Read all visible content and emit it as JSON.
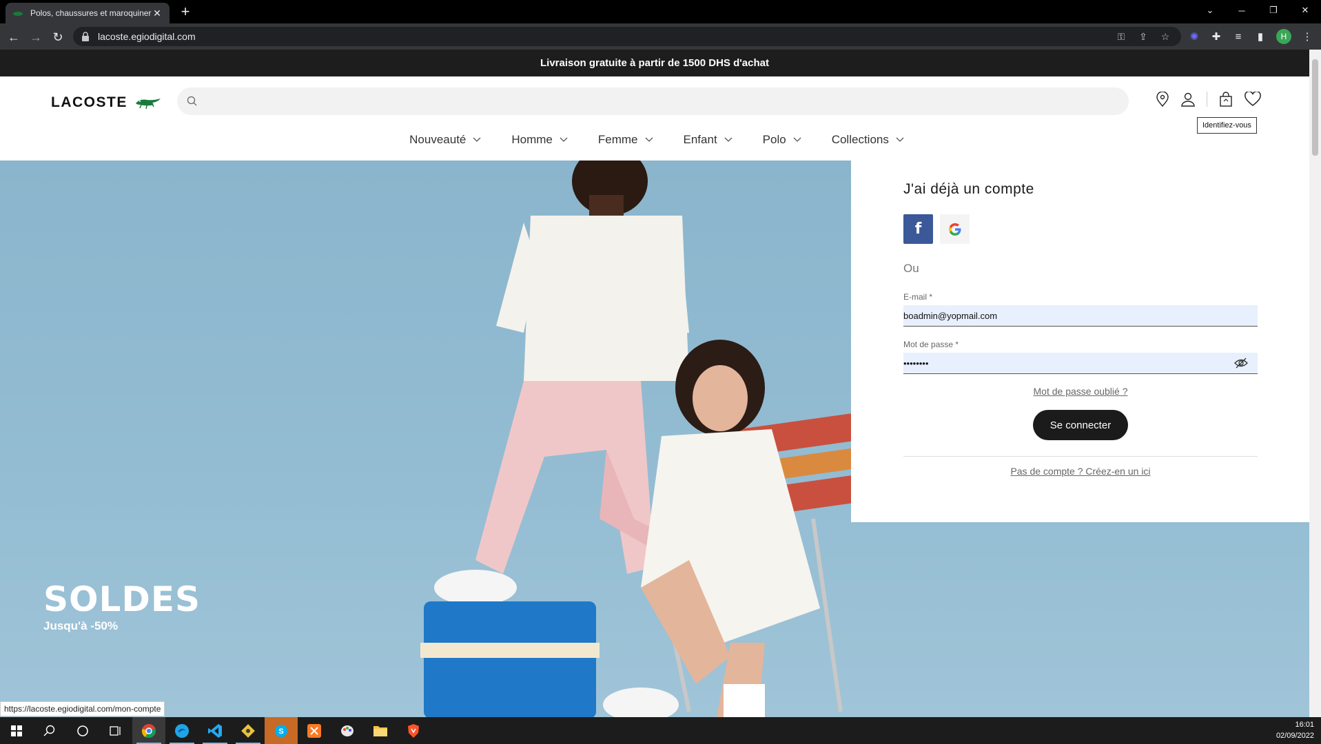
{
  "browser": {
    "tab_title": "Polos, chaussures et maroquinerie",
    "url": "lacoste.egiodigital.com",
    "new_tab_label": "+",
    "close_tab_label": "✕",
    "profile_initial": "H"
  },
  "promo": {
    "text": "Livraison gratuite à partir de 1500 DHS d'achat"
  },
  "header": {
    "logo_text": "LACOSTE",
    "search_placeholder": "",
    "tooltip": "Identifiez-vous"
  },
  "nav": {
    "items": [
      {
        "label": "Nouveauté"
      },
      {
        "label": "Homme"
      },
      {
        "label": "Femme"
      },
      {
        "label": "Enfant"
      },
      {
        "label": "Polo"
      },
      {
        "label": "Collections"
      }
    ]
  },
  "hero": {
    "title": "SOLDES",
    "subtitle": "Jusqu'à -50%"
  },
  "login": {
    "title": "J'ai déjà un compte",
    "facebook_label": "f",
    "or_label": "Ou",
    "email_label": "E-mail *",
    "email_value": "boadmin@yopmail.com",
    "password_label": "Mot de passe *",
    "password_value": "••••••••",
    "forgot_link": "Mot de passe oublié ?",
    "submit_label": "Se connecter",
    "create_link": "Pas de compte ? Créez-en un ici"
  },
  "status_bar": {
    "url": "https://lacoste.egiodigital.com/mon-compte"
  },
  "taskbar": {
    "time": "16:01",
    "date": "02/09/2022"
  },
  "colors": {
    "promo_bg": "#1d1d1d",
    "facebook": "#3b5998",
    "lacoste_green": "#004526",
    "hero_bg": "#8ab5cc",
    "button_dark": "#1b1b1b",
    "autofill_bg": "#e8f0fe"
  }
}
